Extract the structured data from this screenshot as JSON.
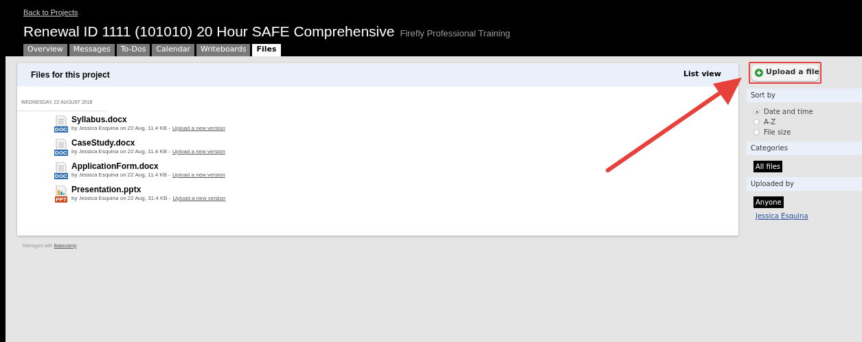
{
  "header": {
    "back_link": "Back to Projects",
    "title": "Renewal ID 1111 (101010) 20 Hour SAFE Comprehensive",
    "company": "Firefly Professional Training"
  },
  "tabs": [
    {
      "label": "Overview",
      "selected": false
    },
    {
      "label": "Messages",
      "selected": false
    },
    {
      "label": "To-Dos",
      "selected": false
    },
    {
      "label": "Calendar",
      "selected": false
    },
    {
      "label": "Writeboards",
      "selected": false
    },
    {
      "label": "Files",
      "selected": true
    }
  ],
  "files_panel": {
    "title": "Files for this project",
    "view_link": "List view",
    "date": "WEDNESDAY, 22 AUGUST 2018",
    "files": [
      {
        "name": "Syllabus.docx",
        "kind": "doc",
        "badge": "DOC",
        "meta": "by Jessica Esquina on 22 Aug, 11.4 KB -",
        "link": "Upload a new version"
      },
      {
        "name": "CaseStudy.docx",
        "kind": "doc",
        "badge": "DOC",
        "meta": "by Jessica Esquina on 22 Aug, 11.4 KB -",
        "link": "Upload a new version"
      },
      {
        "name": "ApplicationForm.docx",
        "kind": "doc",
        "badge": "DOC",
        "meta": "by Jessica Esquina on 22 Aug, 11.4 KB -",
        "link": "Upload a new version"
      },
      {
        "name": "Presentation.pptx",
        "kind": "ppt",
        "badge": "PPT",
        "meta": "by Jessica Esquina on 22 Aug, 31.4 KB -",
        "link": "Upload a new version"
      }
    ]
  },
  "sidebar": {
    "upload_button": "Upload a file",
    "highlighted": true,
    "sections": [
      {
        "title": "Sort by",
        "kind": "radio",
        "options": [
          {
            "label": "Date and time",
            "selected": true
          },
          {
            "label": "A-Z",
            "selected": false
          },
          {
            "label": "File size",
            "selected": false
          }
        ]
      },
      {
        "title": "Categories",
        "kind": "filter",
        "options": [
          {
            "label": "All files",
            "selected": true
          }
        ]
      },
      {
        "title": "Uploaded by",
        "kind": "filter",
        "options": [
          {
            "label": "Anyone",
            "selected": true
          },
          {
            "label": "Jessica Esquina",
            "selected": false
          }
        ]
      }
    ]
  },
  "footer": {
    "text": "Managed with ",
    "link": "Basecamp",
    "suffix": "."
  }
}
